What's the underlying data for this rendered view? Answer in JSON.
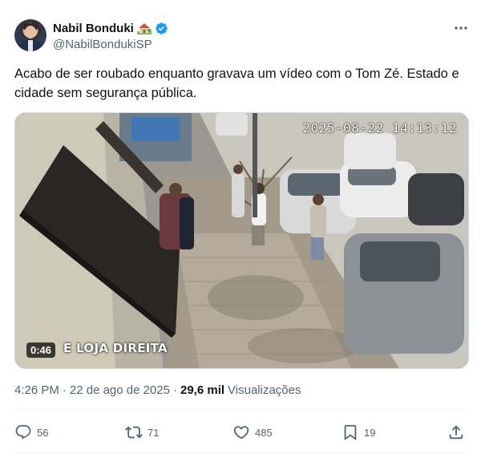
{
  "author": {
    "display_name": "Nabil Bonduki",
    "handle": "@NabilBondukiSP",
    "name_emoji_icon": "house-with-garden-icon",
    "verified_icon": "verified-badge-icon"
  },
  "tweet": {
    "text": "Acabo de ser roubado enquanto gravava um vídeo com o Tom Zé. Estado e cidade sem segurança pública."
  },
  "media": {
    "camera_timestamp": "2025-08-22 14:13:12",
    "duration": "0:46",
    "camera_caption": "E LOJA DIREITA"
  },
  "meta": {
    "time": "4:26 PM",
    "separator": "·",
    "date": "22 de ago de 2025",
    "views_count": "29,6 mil",
    "views_label": "Visualizações"
  },
  "actions": {
    "replies": "56",
    "reposts": "71",
    "likes": "485",
    "bookmarks": "19"
  },
  "colors": {
    "text_primary": "#0f1419",
    "text_secondary": "#536471",
    "verified_blue": "#1d9bf0",
    "divider": "#eff3f4"
  }
}
